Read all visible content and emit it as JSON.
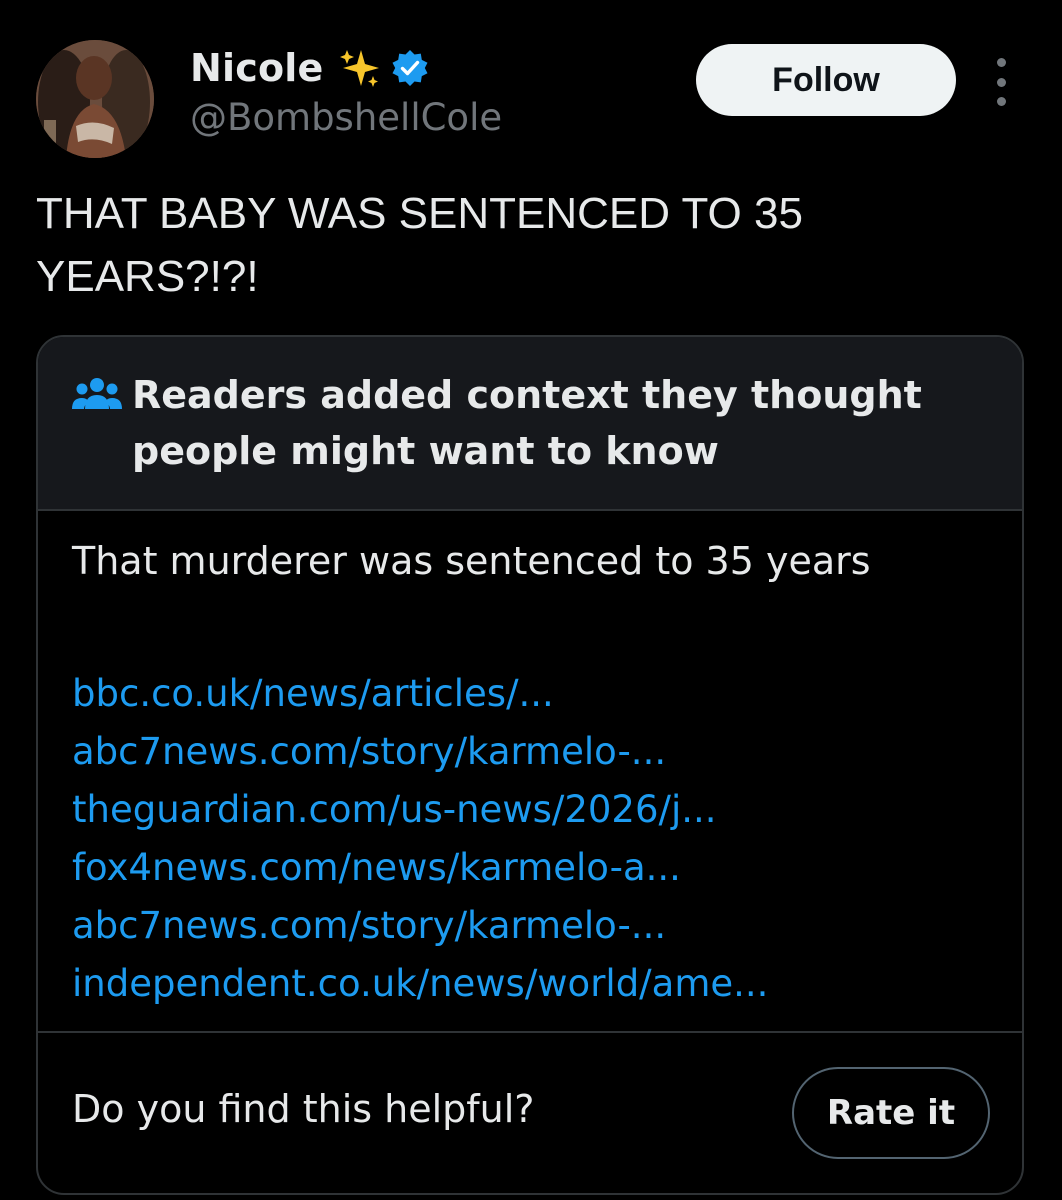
{
  "author": {
    "name": "Nicole",
    "handle": "@BombshellCole",
    "name_emoji_icon": "sparkles-icon",
    "verified_icon": "verified-badge-icon",
    "avatar_icon": "profile-photo"
  },
  "actions": {
    "follow_label": "Follow",
    "more_icon": "more-options-icon"
  },
  "tweet": {
    "text": "THAT BABY WAS SENTENCED TO 35 YEARS?!?!"
  },
  "community_note": {
    "icon": "people-icon",
    "title": "Readers added context they thought people might want to know",
    "text": "That murderer was sentenced to 35 years",
    "links": [
      "bbc.co.uk/news/articles/...",
      "abc7news.com/story/karmelo-...",
      "theguardian.com/us-news/2026/j...",
      "fox4news.com/news/karmelo-a...",
      "abc7news.com/story/karmelo-...",
      "independent.co.uk/news/world/ame..."
    ],
    "helpful_prompt": "Do you find this helpful?",
    "rate_label": "Rate it"
  },
  "colors": {
    "background": "#000000",
    "text_primary": "#e7e9ea",
    "text_secondary": "#71767b",
    "link": "#1d9bf0",
    "verified": "#1d9bf0",
    "border": "#2f3336",
    "note_header_bg": "#16181c"
  }
}
